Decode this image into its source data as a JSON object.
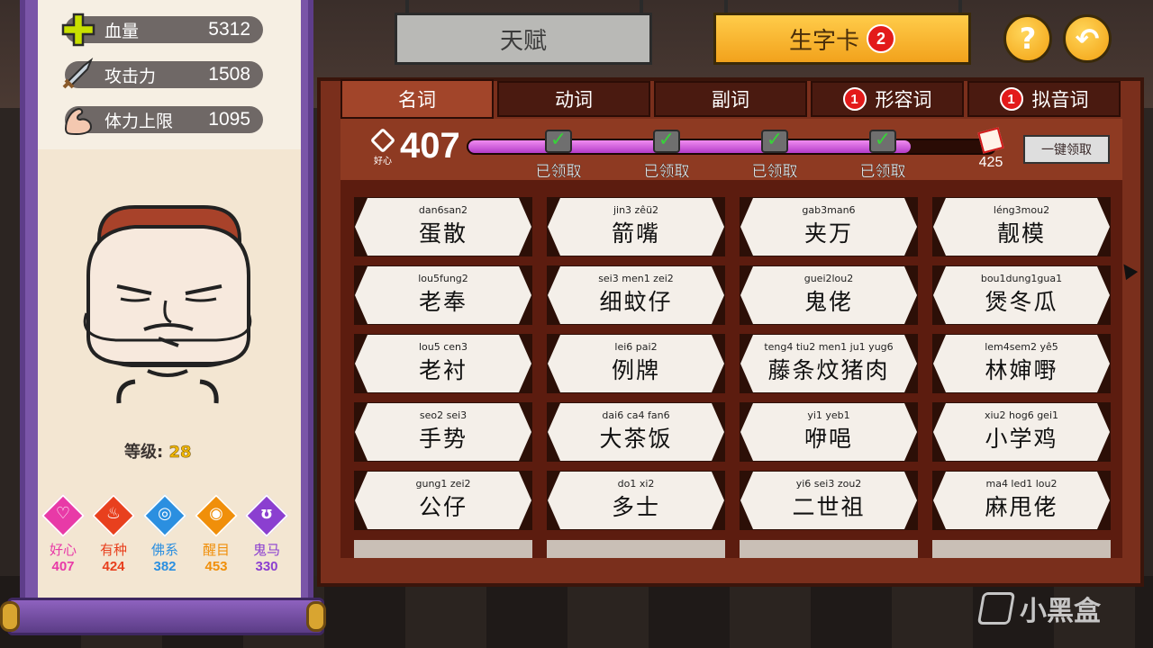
{
  "stats": [
    {
      "label": "血量",
      "value": "5312",
      "icon": "plus-icon",
      "color": "#c8e000"
    },
    {
      "label": "攻击力",
      "value": "1508",
      "icon": "sword-icon",
      "color": "#9fb0c0"
    },
    {
      "label": "体力上限",
      "value": "1095",
      "icon": "muscle-arm-icon",
      "color": "#f4c8b0"
    }
  ],
  "level": {
    "label": "等级:",
    "value": "28"
  },
  "attributes": [
    {
      "name": "好心",
      "value": "407",
      "color": "#e83aa7",
      "glyph": "♡"
    },
    {
      "name": "有种",
      "value": "424",
      "color": "#e8401e",
      "glyph": "♨"
    },
    {
      "name": "佛系",
      "value": "382",
      "color": "#2b8fe0",
      "glyph": "◎"
    },
    {
      "name": "醒目",
      "value": "453",
      "color": "#f08f0a",
      "glyph": "◉"
    },
    {
      "name": "鬼马",
      "value": "330",
      "color": "#8b3fd0",
      "glyph": "ʊ"
    }
  ],
  "signs": {
    "talent": "天赋",
    "cards": "生字卡",
    "cards_badge": "2"
  },
  "buttons": {
    "help": "?",
    "back": "↶"
  },
  "tabs": [
    {
      "label": "名词",
      "active": true,
      "badge": ""
    },
    {
      "label": "动词",
      "active": false,
      "badge": ""
    },
    {
      "label": "副词",
      "active": false,
      "badge": ""
    },
    {
      "label": "形容词",
      "active": false,
      "badge": "1"
    },
    {
      "label": "拟音词",
      "active": false,
      "badge": "1"
    }
  ],
  "progress": {
    "icon_label": "好心",
    "current": "407",
    "fill_fraction": 0.84,
    "milestones": [
      "已领取",
      "已领取",
      "已领取",
      "已领取"
    ],
    "next_reward": "425",
    "claim_all": "一键领取"
  },
  "cards": [
    {
      "py": "dan6san2",
      "hz": "蛋散"
    },
    {
      "py": "jin3 zêü2",
      "hz": "箭嘴"
    },
    {
      "py": "gab3man6",
      "hz": "夹万"
    },
    {
      "py": "léng3mou2",
      "hz": "靓模"
    },
    {
      "py": "lou5fung2",
      "hz": "老奉"
    },
    {
      "py": "sei3 men1 zei2",
      "hz": "细蚊仔"
    },
    {
      "py": "guei2lou2",
      "hz": "鬼佬"
    },
    {
      "py": "bou1dung1gua1",
      "hz": "煲冬瓜"
    },
    {
      "py": "lou5 cen3",
      "hz": "老衬"
    },
    {
      "py": "lei6  pai2",
      "hz": "例牌"
    },
    {
      "py": "teng4 tiu2 men1  ju1  yug6",
      "hz": "藤条炆猪肉"
    },
    {
      "py": "lem4sem2 yê5",
      "hz": "林婶嘢"
    },
    {
      "py": "seo2 sei3",
      "hz": "手势"
    },
    {
      "py": "dai6  ca4  fan6",
      "hz": "大茶饭"
    },
    {
      "py": "yi1  yeb1",
      "hz": "咿唈"
    },
    {
      "py": "xiu2 hog6 gei1",
      "hz": "小学鸡"
    },
    {
      "py": "gung1 zei2",
      "hz": "公仔"
    },
    {
      "py": "do1   xi2",
      "hz": "多士"
    },
    {
      "py": "yi6   sei3 zou2",
      "hz": "二世祖"
    },
    {
      "py": "ma4 led1 lou2",
      "hz": "麻甩佬"
    }
  ],
  "watermark": "小黑盒"
}
